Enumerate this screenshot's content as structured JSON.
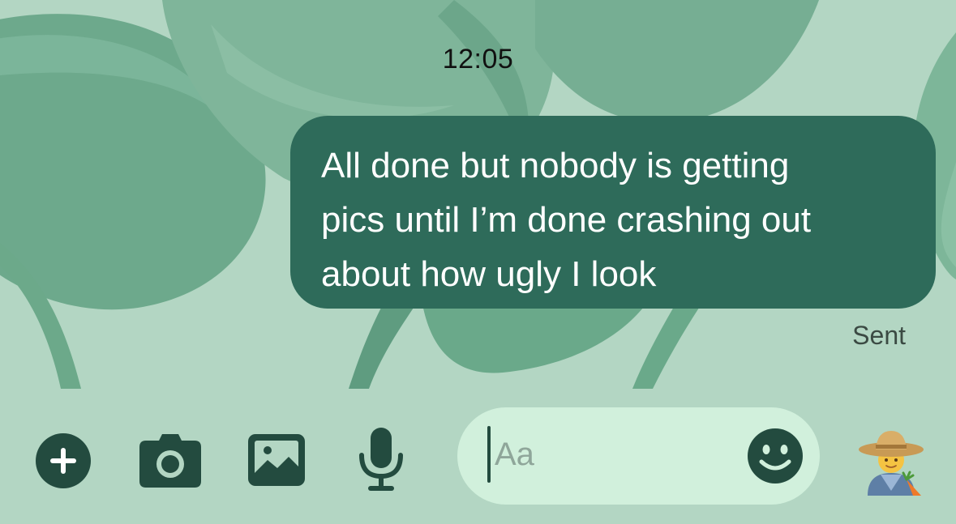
{
  "thread": {
    "timestamp": "12:05",
    "messages": [
      {
        "direction": "outgoing",
        "lines": [
          "All done but nobody is getting",
          "pics until I’m done crashing out",
          "about how ugly I look"
        ],
        "status": "Sent"
      }
    ]
  },
  "composer": {
    "input_value": "",
    "placeholder": "Aa",
    "buttons": {
      "add": "plus-icon",
      "camera": "camera-icon",
      "gallery": "image-icon",
      "voice": "microphone-icon",
      "emoji": "smiley-icon"
    },
    "profile_avatar": "farmer-emoji"
  },
  "theme": {
    "wallpaper": "green-leaves",
    "background": "#b3d6c3",
    "bubble": "#2e6b5a",
    "icons": "#234b3f",
    "input_background": "#d1f0dc"
  }
}
